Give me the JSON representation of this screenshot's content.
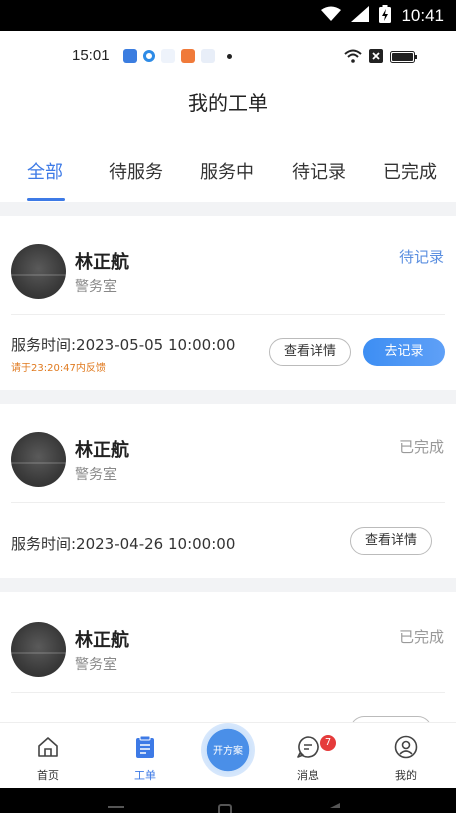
{
  "system_bar": {
    "time": "10:41"
  },
  "inner_status": {
    "time": "15:01"
  },
  "header": {
    "title": "我的工单"
  },
  "tabs": [
    {
      "label": "全部",
      "active": true
    },
    {
      "label": "待服务",
      "active": false
    },
    {
      "label": "服务中",
      "active": false
    },
    {
      "label": "待记录",
      "active": false
    },
    {
      "label": "已完成",
      "active": false
    }
  ],
  "orders": [
    {
      "name": "林正航",
      "dept": "警务室",
      "status": "待记录",
      "service_time": "服务时间:2023-05-05 10:00:00",
      "warning": "请于23:20:47内反馈",
      "detail_label": "查看详情",
      "record_label": "去记录"
    },
    {
      "name": "林正航",
      "dept": "警务室",
      "status": "已完成",
      "service_time": "服务时间:2023-04-26 10:00:00",
      "detail_label": "查看详情"
    },
    {
      "name": "林正航",
      "dept": "警务室",
      "status": "已完成"
    }
  ],
  "bottom_nav": {
    "home": "首页",
    "orders": "工单",
    "center": "开方案",
    "messages": "消息",
    "messages_badge": "7",
    "mine": "我的"
  },
  "colors": {
    "accent": "#3d7ae6",
    "pending": "#5b8fe0",
    "warning": "#e07a1f",
    "badge": "#e53b3b"
  }
}
